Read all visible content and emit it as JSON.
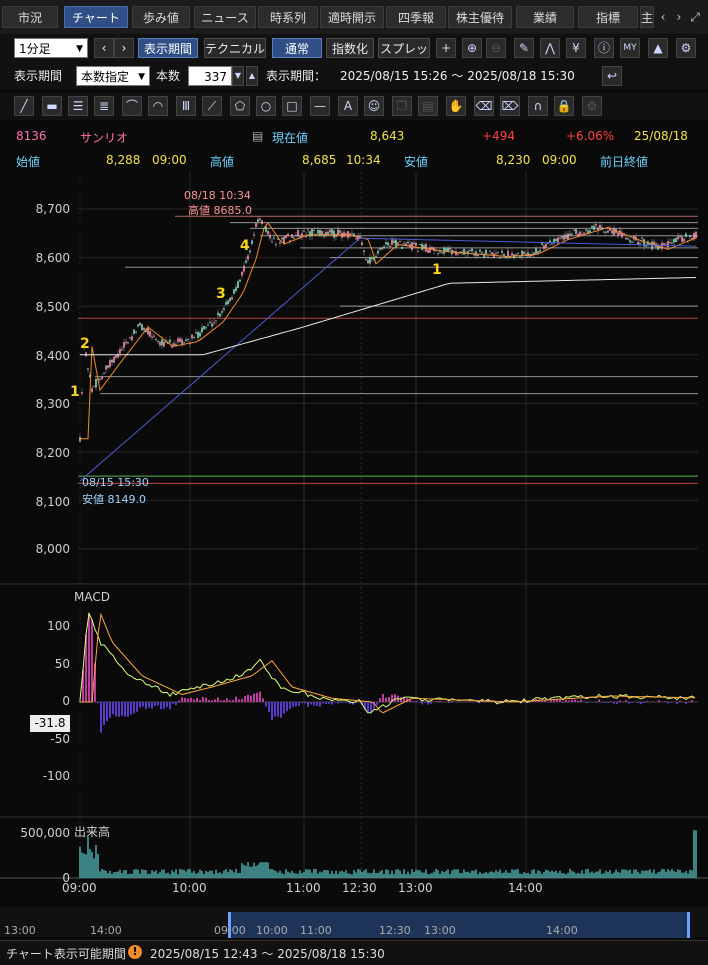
{
  "tabs": [
    "市況",
    "チャート",
    "歩み値",
    "ニュース",
    "時系列",
    "適時開示",
    "四季報",
    "株主優待",
    "業績",
    "指標",
    "主"
  ],
  "active_tab": 1,
  "toolbar": {
    "interval": "1分足",
    "period_mode": "表示期間",
    "technical": "テクニカル",
    "normal": "通常",
    "index": "指数化",
    "spread": "スプレッド"
  },
  "period": {
    "label": "表示期間",
    "mode_value": "本数指定",
    "count_label": "本数",
    "count_value": "337",
    "range_label": "表示期間：",
    "range_value": "2025/08/15 15:26 ～ 2025/08/18 15:30"
  },
  "stock": {
    "code": "8136",
    "name": "サンリオ",
    "current_label": "現在値",
    "current_value": "8,643",
    "change": "+494",
    "change_pct": "+6.06%",
    "date": "25/08/18",
    "open_label": "始値",
    "open_value": "8,288",
    "open_time": "09:00",
    "high_label": "高値",
    "high_value": "8,685",
    "high_time": "10:34",
    "low_label": "安値",
    "low_value": "8,230",
    "low_time": "09:00",
    "prev_close_label": "前日終値"
  },
  "colors": {
    "up": "#ff4040",
    "pos_yellow": "#f2e14a",
    "code": "#ff6fae",
    "label_cyan": "#6fd3ff",
    "price_green": "#9cff8a",
    "macd_line": "#d8ff7a",
    "signal_line": "#ffa640",
    "ma_orange": "#f08a2a",
    "ma_blue": "#4a5bd6",
    "ma_white": "#e8e8e8"
  },
  "price_axis": [
    "8,700",
    "8,600",
    "8,500",
    "8,400",
    "8,300",
    "8,200",
    "8,100",
    "8,000"
  ],
  "high_annotation": {
    "time": "08/18 10:34",
    "text": "高値 8685.0"
  },
  "low_annotation": {
    "time": "08/15 15:30",
    "text": "安値 8149.0"
  },
  "wave_labels": [
    {
      "text": "1",
      "time": "09:01",
      "price": 8298
    },
    {
      "text": "2",
      "time": "09:02",
      "price": 8410
    },
    {
      "text": "3",
      "time": "10:24",
      "price": 8510
    },
    {
      "text": "4",
      "time": "10:32",
      "price": 8620
    },
    {
      "text": "1",
      "time": "13:05",
      "price": 8575
    }
  ],
  "macd": {
    "title": "MACD",
    "axis": [
      "100",
      "50",
      "0",
      "-50",
      "-100"
    ],
    "current": "-31.8"
  },
  "volume": {
    "title": "出来高",
    "axis": [
      "500,000",
      "0"
    ]
  },
  "time_axis": [
    "09:00",
    "10:00",
    "11:00",
    "12:30",
    "13:00",
    "14:00"
  ],
  "navigator_axis": [
    "13:00",
    "14:00",
    "09:00",
    "10:00",
    "11:00",
    "12:30",
    "13:00",
    "14:00"
  ],
  "footer": {
    "label": "チャート表示可能期間",
    "range": "2025/08/15 12:43 ～ 2025/08/18 15:30"
  }
}
